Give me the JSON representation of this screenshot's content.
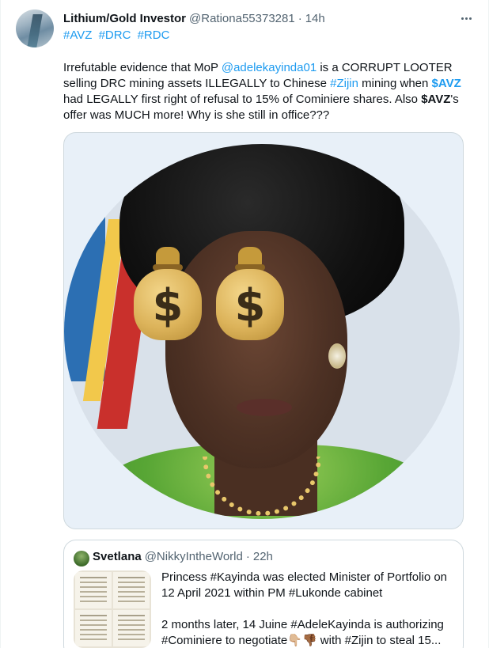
{
  "tweet": {
    "author_name": "Lithium/Gold Investor",
    "author_handle": "@Rationa55373281",
    "dot": "·",
    "time": "14h",
    "hashtags": [
      "#AVZ",
      "#DRC",
      "#RDC"
    ],
    "text": {
      "p1": "Irrefutable evidence that MoP ",
      "mention": "@adelekayinda01",
      "p2": " is a CORRUPT LOOTER selling DRC mining assets ILLEGALLY to Chinese ",
      "zijin": "#Zijin",
      "p3": " mining when ",
      "cashtag1": "$AVZ",
      "p4": " had LEGALLY first right of refusal to 15% of Cominiere shares. Also ",
      "cashtag2": "$AVZ",
      "p5": "'s offer was MUCH more! Why is she still in office???"
    },
    "media": {
      "emoji_left": "$",
      "emoji_right": "$"
    }
  },
  "quote": {
    "author_name": "Svetlana",
    "author_handle": "@NikkyIntheWorld",
    "dot": "·",
    "time": "22h",
    "line1": "Princess #Kayinda was elected Minister of Portfolio on 12 April 2021 within PM #Lukonde cabinet",
    "line2": "2 months later, 14 Juine #AdeleKayinda is authorizing #Cominiere to negotiate👇🏼👎🏾 with #Zijin to steal 15..."
  },
  "colors": {
    "link": "#1d9bf0",
    "text": "#0f1419",
    "muted": "#536471",
    "border": "#cfd9de"
  },
  "icons": {
    "more": "more-icon",
    "money_bag": "money-bag-icon"
  }
}
